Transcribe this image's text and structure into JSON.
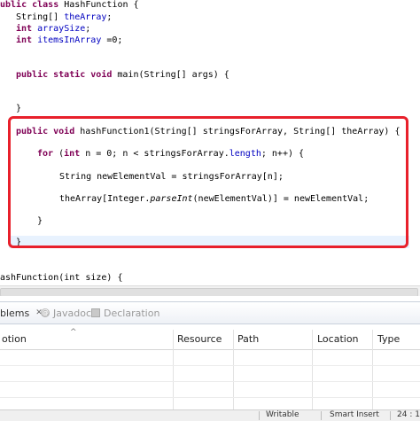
{
  "editor": {
    "lines": {
      "l1_kw": "ublic class",
      "l1_rest": " HashFunction {",
      "l2_type": "String[]",
      "l2_field": "theArray",
      "l2_end": ";",
      "l3_kw": "int",
      "l3_field": "arraySize",
      "l3_end": ";",
      "l4_kw": "int",
      "l4_field": "itemsInArray",
      "l4_end": " =0;",
      "l5_kw": "public static void",
      "l5_rest": " main(String[] args) {",
      "l6_brace": "}",
      "l7_kw": "public void",
      "l7_rest": " hashFunction1(String[] stringsForArray, String[] theArray) {",
      "l8_kw1": "for",
      "l8_a": " (",
      "l8_kw2": "int",
      "l8_b": " n = 0; n < stringsForArray.",
      "l8_field": "length",
      "l8_c": "; n++) {",
      "l9": "String newElementVal = stringsForArray[n];",
      "l10_a": "theArray[Integer.",
      "l10_it": "parseInt",
      "l10_b": "(newElementVal)] = newElementVal;",
      "l11_brace": "}",
      "l12_brace": "}",
      "l13": "ashFunction(int size) {"
    }
  },
  "bottom_panel": {
    "tabs": {
      "problems": "blems",
      "javadoc": "Javadoc",
      "declaration": "Declaration"
    },
    "columns": {
      "description": "otion",
      "resource": "Resource",
      "path": "Path",
      "location": "Location",
      "type": "Type"
    }
  },
  "statusbar": {
    "writable": "Writable",
    "insert_mode": "Smart Insert",
    "position": "24 : 1"
  },
  "colors": {
    "keyword": "#7f0055",
    "field": "#0000c0",
    "highlight_box": "#e8202b",
    "current_line": "#e8f2fe"
  },
  "icons": {
    "problems_close": "close-icon",
    "javadoc": "javadoc-icon",
    "declaration": "declaration-icon",
    "sort": "sort-arrow-icon"
  }
}
